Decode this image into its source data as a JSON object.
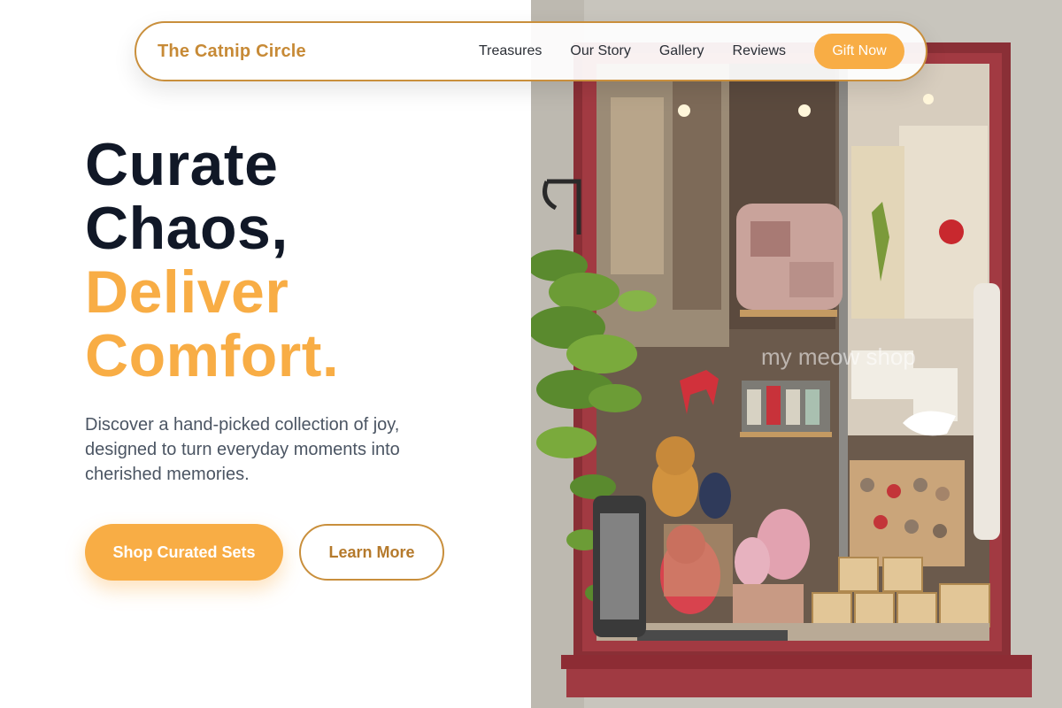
{
  "nav": {
    "brand": "The Catnip Circle",
    "links": [
      "Treasures",
      "Our Story",
      "Gallery",
      "Reviews"
    ],
    "cta": "Gift Now"
  },
  "hero": {
    "headline_dark_1": "Curate",
    "headline_dark_2": "Chaos,",
    "headline_accent_1": "Deliver",
    "headline_accent_2": "Comfort.",
    "subtitle": "Discover a hand-picked collection of joy, designed to turn everyday moments into cherished memories.",
    "primary_cta": "Shop Curated Sets",
    "secondary_cta": "Learn More"
  },
  "photo": {
    "watermark": "my meow shop"
  },
  "colors": {
    "accent": "#f8ad45",
    "accent_dark": "#c78a36",
    "heading": "#111827",
    "body": "#4b5563"
  }
}
